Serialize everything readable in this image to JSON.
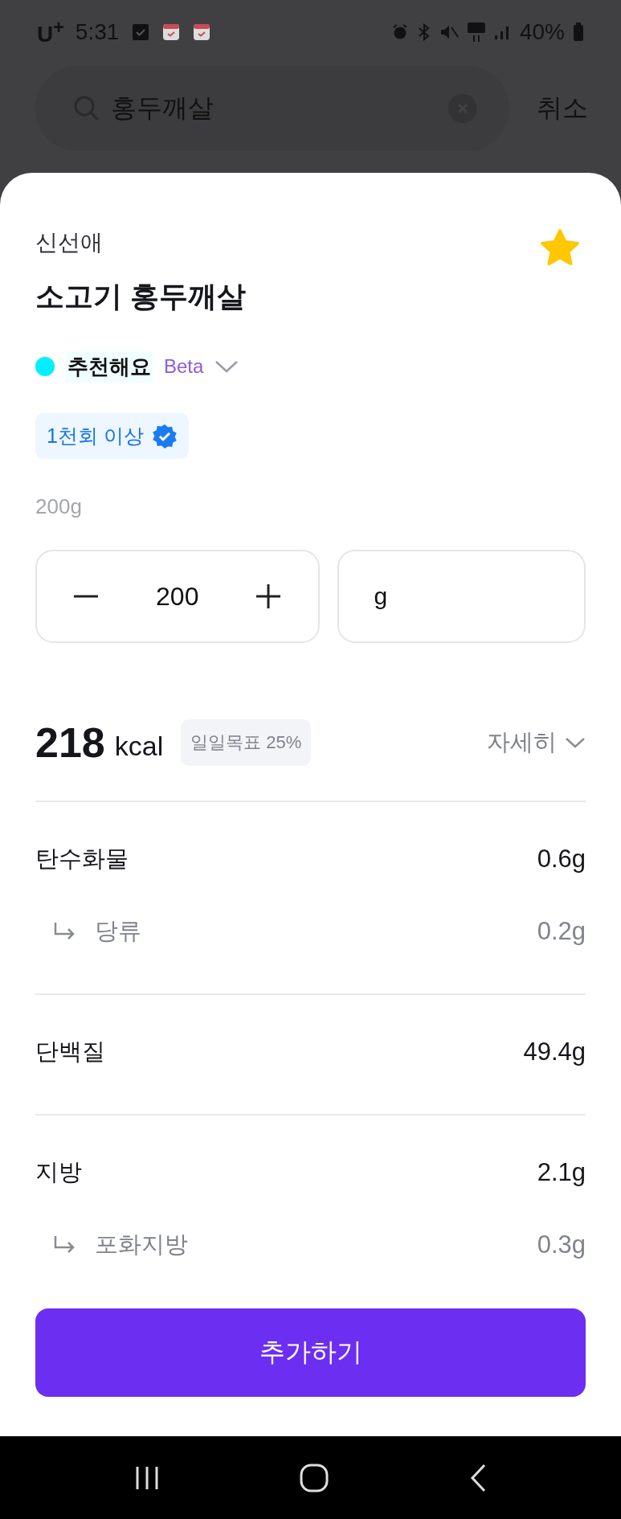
{
  "status_bar": {
    "carrier": "U$^{+}$",
    "time": "5:31",
    "battery": "40%"
  },
  "search": {
    "value": "홍두깨살",
    "cancel": "취소"
  },
  "food": {
    "brand": "신선애",
    "name": "소고기 홍두깨살",
    "favorite": true
  },
  "recommendation": {
    "color": "#00f0ff",
    "label": "추천해요",
    "badge": "Beta"
  },
  "tag": {
    "label": "1천회 이상"
  },
  "serving": {
    "label": "200g",
    "quantity": "200",
    "unit": "g"
  },
  "calories": {
    "value": "218",
    "unit": "kcal",
    "daily_goal": "일일목표 25%",
    "details": "자세히"
  },
  "nutrients": [
    {
      "name": "탄수화물",
      "amount": "0.6g",
      "children": [
        {
          "name": "당류",
          "amount": "0.2g"
        }
      ]
    },
    {
      "name": "단백질",
      "amount": "49.4g"
    },
    {
      "name": "지방",
      "amount": "2.1g",
      "children": [
        {
          "name": "포화지방",
          "amount": "0.3g"
        }
      ]
    }
  ],
  "add_button": "추가하기"
}
